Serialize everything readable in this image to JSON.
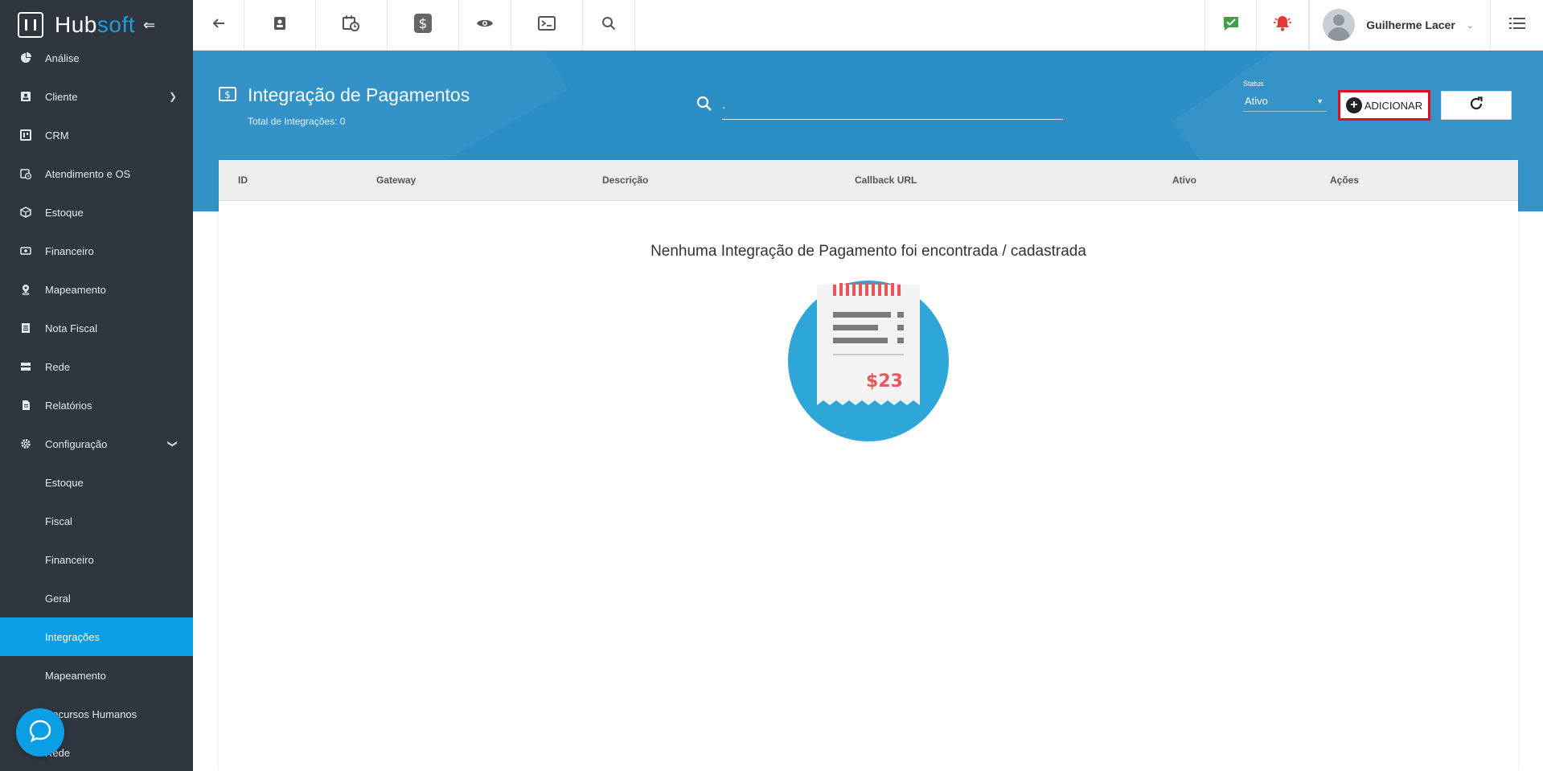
{
  "brand": {
    "name_part1": "Hub",
    "name_part2": "soft"
  },
  "sidebar": {
    "items": [
      {
        "label": "Análise"
      },
      {
        "label": "Cliente"
      },
      {
        "label": "CRM"
      },
      {
        "label": "Atendimento e OS"
      },
      {
        "label": "Estoque"
      },
      {
        "label": "Financeiro"
      },
      {
        "label": "Mapeamento"
      },
      {
        "label": "Nota Fiscal"
      },
      {
        "label": "Rede"
      },
      {
        "label": "Relatórios"
      },
      {
        "label": "Configuração"
      }
    ],
    "subitems": [
      {
        "label": "Estoque"
      },
      {
        "label": "Fiscal"
      },
      {
        "label": "Financeiro"
      },
      {
        "label": "Geral"
      },
      {
        "label": "Integrações",
        "active": true
      },
      {
        "label": "Mapeamento"
      },
      {
        "label": "Recursos Humanos"
      },
      {
        "label": "Rede"
      }
    ]
  },
  "topbar": {
    "user_name": "Guilherme Lacer"
  },
  "header": {
    "title": "Integração de Pagamentos",
    "subtitle": "Total de Integrações: 0",
    "search_value": ".",
    "status_label": "Status",
    "status_value": "Ativo",
    "add_label": "ADICIONAR"
  },
  "table": {
    "columns": [
      "ID",
      "Gateway",
      "Descrição",
      "Callback URL",
      "Ativo",
      "Ações"
    ],
    "rows": []
  },
  "empty": {
    "message": "Nenhuma Integração de Pagamento foi encontrada / cadastrada",
    "amount": "$23"
  },
  "colors": {
    "sidebar_bg": "#2f3640",
    "active_item": "#0a9ee4",
    "band_bg": "#2b8ec5",
    "alert_red": "#e0101f",
    "chat_green": "#43a047"
  },
  "icons": {
    "back": "arrow-left-icon",
    "contact": "contact-card-icon",
    "calendar": "calendar-clock-icon",
    "money": "dollar-icon",
    "view": "eye-icon",
    "terminal": "terminal-icon",
    "search": "search-icon",
    "chat": "chat-check-icon",
    "bell": "bell-icon",
    "menu": "list-menu-icon"
  }
}
